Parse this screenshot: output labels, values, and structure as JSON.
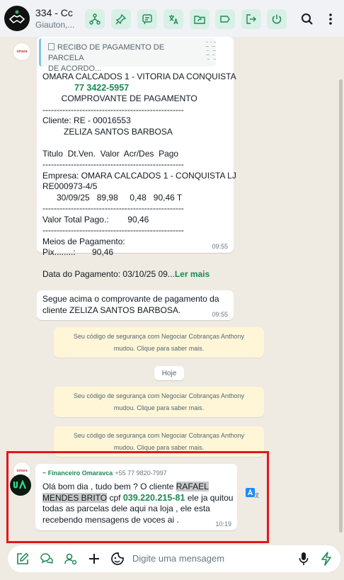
{
  "header": {
    "title": "334 - Cc",
    "subtitle": "Giauton,..."
  },
  "receipt": {
    "doc_title_line1": "RECIBO DE PAGAMENTO DE PARCELA",
    "doc_title_line2": "DE ACORDO...",
    "lines": [
      "OMARA CALCADOS 1 - VITORIA DA CONQUISTA",
      "",
      "        COMPROVANTE DE PAGAMENTO",
      "--------------------------------------------------",
      "Cliente: RE - 00016553",
      "         ZELIZA SANTOS BARBOSA",
      "",
      "Titulo  Dt.Ven.  Valor  Acr/Des  Pago",
      "--------------------------------------------------",
      "Empresa: OMARA CALCADOS 1 - CONQUISTA LJ",
      "RE000973-4/5",
      "      30/09/25   89,98     0,48   90,46 T",
      "--------------------------------------------------",
      "Valor Total Pago.:        90,46",
      "--------------------------------------------------",
      "Meios de Pagamento:",
      "Pix........:       90,46",
      "",
      "Data do Pagamento: 03/10/25 09..."
    ],
    "phone": "77 3422-5957",
    "read_more": "Ler mais",
    "time": "09:55"
  },
  "message2": {
    "line1": "Segue acima o comprovante de pagamento da",
    "line2": "cliente ZELIZA SANTOS BARBOSA.",
    "time": "09:55"
  },
  "system_messages": {
    "security_line1": "Seu código de segurança com Negociar Cobranças Anthony",
    "security_line2": "mudou. Clique para saber mais.",
    "day": "Hoje"
  },
  "message3": {
    "sender_name": "~ Financeiro Omaravca",
    "sender_phone": "+55 77 9820-7997",
    "line1_a": "Olá bom dia , tudo bem ? O cliente ",
    "line1_b": "RAFAEL",
    "line2_a": "MENDES BRITO",
    "line2_b": " cpf ",
    "cpf": "039.220.215-81",
    "line2_c": " ele ja quitou",
    "line3": "todas as parcelas dele aqui na loja , ele esta",
    "line4": "recebendo mensagens de voces ai .",
    "time": "10:19"
  },
  "composer": {
    "placeholder": "Digite uma mensagem"
  },
  "colors": {
    "accent_green": "#1a8a55",
    "toolbar_button_bg": "#d9f0e6",
    "highlight_box": "#e3161b"
  }
}
